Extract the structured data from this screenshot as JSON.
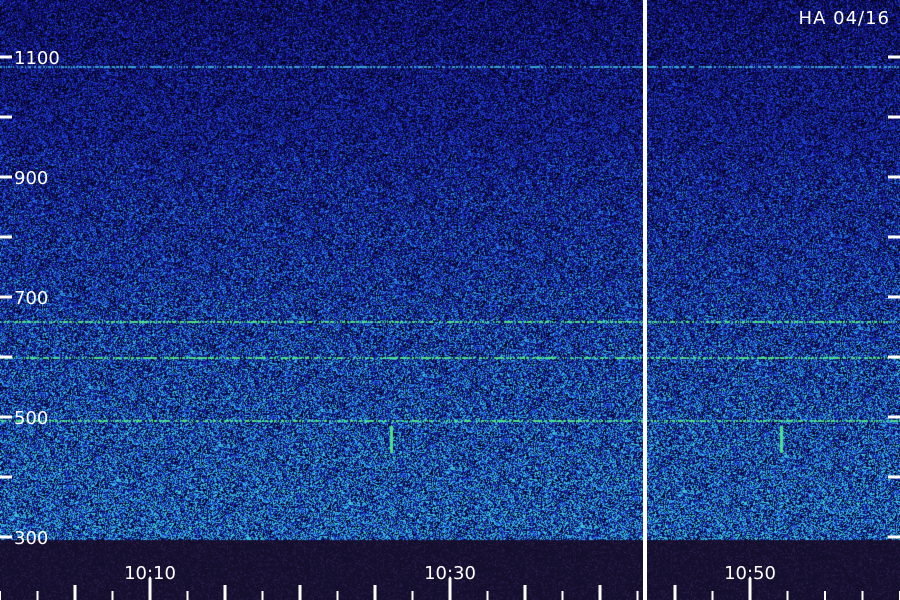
{
  "station_label": "HA 04/16",
  "colors": {
    "background": "#05051a",
    "noise_low": "#1a1a9a",
    "noise_mid": "#1f4fd0",
    "noise_high": "#2aa8e0",
    "band_line": "#4fe08a",
    "axis": "#ffffff",
    "timeline_strip": "#150f2e",
    "gap_line": "#ffffff"
  },
  "chart_data": {
    "type": "heatmap",
    "title": "",
    "xlabel": "",
    "ylabel": "",
    "y_ticks": [
      1100,
      900,
      700,
      500,
      300
    ],
    "x_ticks": [
      "10:10",
      "10:30",
      "10:50"
    ],
    "data_gap_marker": "between 10:30 and 10:50",
    "horizontal_bands": [
      1085,
      660,
      600,
      495
    ],
    "bursts": [
      {
        "time": "10:26",
        "freq_range": [
          440,
          485
        ]
      },
      {
        "time": "10:52",
        "freq_range": [
          440,
          485
        ]
      }
    ]
  }
}
